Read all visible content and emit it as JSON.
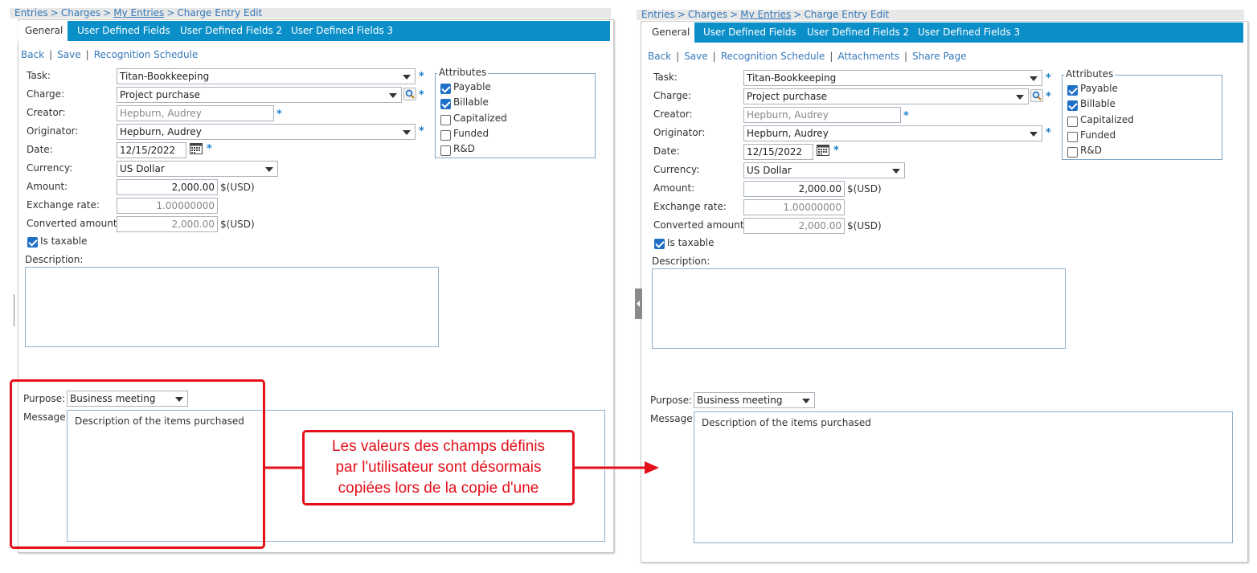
{
  "breadcrumb": {
    "items": [
      "Entries",
      "Charges",
      "My Entries",
      "Charge Entry Edit"
    ],
    "separator": ">"
  },
  "tabs": [
    {
      "label": "General",
      "active": true
    },
    {
      "label": "User Defined Fields",
      "active": false
    },
    {
      "label": "User Defined Fields 2",
      "active": false
    },
    {
      "label": "User Defined Fields 3",
      "active": false
    }
  ],
  "left_actions": [
    "Back",
    "Save",
    "Recognition Schedule"
  ],
  "right_actions": [
    "Back",
    "Save",
    "Recognition Schedule",
    "Attachments",
    "Share Page"
  ],
  "form": {
    "task_label": "Task:",
    "task_value": "Titan-Bookkeeping",
    "charge_label": "Charge:",
    "charge_value": "Project purchase",
    "creator_label": "Creator:",
    "creator_value": "Hepburn, Audrey",
    "originator_label": "Originator:",
    "originator_value": "Hepburn, Audrey",
    "date_label": "Date:",
    "date_value": "12/15/2022",
    "currency_label": "Currency:",
    "currency_value": "US Dollar",
    "amount_label": "Amount:",
    "amount_value": "2,000.00",
    "amount_unit": "$(USD)",
    "exchange_label": "Exchange rate:",
    "exchange_value": "1.00000000",
    "converted_label": "Converted amount:",
    "converted_value": "2,000.00",
    "converted_unit": "$(USD)",
    "taxable_label": "Is taxable",
    "taxable_checked": true,
    "description_label": "Description:",
    "required_mark": "*"
  },
  "attributes": {
    "legend": "Attributes",
    "items": [
      {
        "label": "Payable",
        "checked": true
      },
      {
        "label": "Billable",
        "checked": true
      },
      {
        "label": "Capitalized",
        "checked": false
      },
      {
        "label": "Funded",
        "checked": false
      },
      {
        "label": "R&D",
        "checked": false
      }
    ]
  },
  "udf": {
    "purpose_label": "Purpose:",
    "purpose_value": "Business meeting",
    "message_label": "Message",
    "message_value": "Description of the items purchased"
  },
  "callout": {
    "lines": [
      "Les valeurs des champs définis",
      "par l'utilisateur sont désormais",
      "copiées lors de la copie d'une"
    ]
  },
  "colors": {
    "tab_bar": "#0b8fc9",
    "link": "#3578b8",
    "highlight": "#e3101a",
    "required": "#1e7fc8"
  }
}
